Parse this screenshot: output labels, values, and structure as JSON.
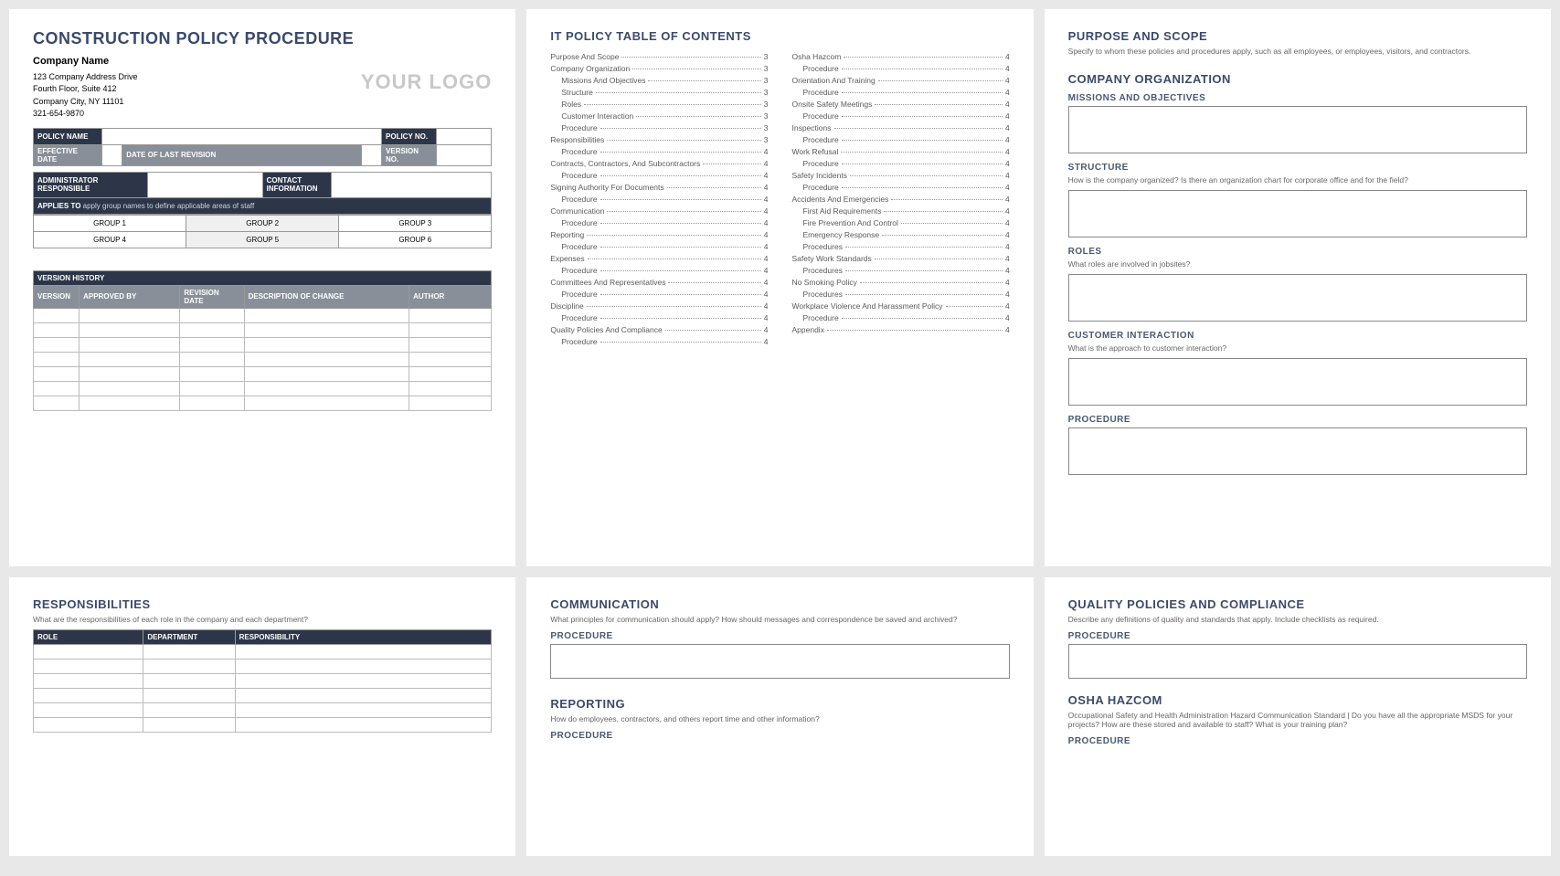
{
  "p1": {
    "title": "CONSTRUCTION POLICY PROCEDURE",
    "company_name": "Company Name",
    "addr1": "123 Company Address Drive",
    "addr2": "Fourth Floor, Suite 412",
    "addr3": "Company City, NY  11101",
    "phone": "321-654-9870",
    "logo": "YOUR LOGO",
    "policy_name": "POLICY NAME",
    "policy_no": "POLICY NO.",
    "effective_date": "EFFECTIVE DATE",
    "last_rev": "DATE OF LAST REVISION",
    "version_no": "VERSION NO.",
    "admin": "ADMINISTRATOR RESPONSIBLE",
    "contact": "CONTACT INFORMATION",
    "applies_lbl": "APPLIES TO",
    "applies_txt": "apply group names to define applicable areas of staff",
    "g1": "GROUP 1",
    "g2": "GROUP 2",
    "g3": "GROUP 3",
    "g4": "GROUP 4",
    "g5": "GROUP 5",
    "g6": "GROUP 6",
    "ver_hist": "VERSION HISTORY",
    "vh_version": "VERSION",
    "vh_approved": "APPROVED BY",
    "vh_revdate": "REVISION DATE",
    "vh_desc": "DESCRIPTION OF CHANGE",
    "vh_author": "AUTHOR"
  },
  "p2": {
    "title": "IT POLICY TABLE OF CONTENTS",
    "col1": [
      {
        "t": "Purpose And Scope",
        "p": "3",
        "i": 0
      },
      {
        "t": "Company Organization",
        "p": "3",
        "i": 0
      },
      {
        "t": "Missions And Objectives",
        "p": "3",
        "i": 1
      },
      {
        "t": "Structure",
        "p": "3",
        "i": 1
      },
      {
        "t": "Roles",
        "p": "3",
        "i": 1
      },
      {
        "t": "Customer Interaction",
        "p": "3",
        "i": 1
      },
      {
        "t": "Procedure",
        "p": "3",
        "i": 1
      },
      {
        "t": "Responsibilities",
        "p": "3",
        "i": 0
      },
      {
        "t": "Procedure",
        "p": "4",
        "i": 1
      },
      {
        "t": "Contracts, Contractors, And Subcontractors",
        "p": "4",
        "i": 0
      },
      {
        "t": "Procedure",
        "p": "4",
        "i": 1
      },
      {
        "t": "Signing Authority For Documents",
        "p": "4",
        "i": 0
      },
      {
        "t": "Procedure",
        "p": "4",
        "i": 1
      },
      {
        "t": "Communication",
        "p": "4",
        "i": 0
      },
      {
        "t": "Procedure",
        "p": "4",
        "i": 1
      },
      {
        "t": "Reporting",
        "p": "4",
        "i": 0
      },
      {
        "t": "Procedure",
        "p": "4",
        "i": 1
      },
      {
        "t": "Expenses",
        "p": "4",
        "i": 0
      },
      {
        "t": "Procedure",
        "p": "4",
        "i": 1
      },
      {
        "t": "Committees And Representatives",
        "p": "4",
        "i": 0
      },
      {
        "t": "Procedure",
        "p": "4",
        "i": 1
      },
      {
        "t": "Discipline",
        "p": "4",
        "i": 0
      },
      {
        "t": "Procedure",
        "p": "4",
        "i": 1
      },
      {
        "t": "Quality Policies And Compliance",
        "p": "4",
        "i": 0
      },
      {
        "t": "Procedure",
        "p": "4",
        "i": 1
      }
    ],
    "col2": [
      {
        "t": "Osha Hazcom",
        "p": "4",
        "i": 0
      },
      {
        "t": "Procedure",
        "p": "4",
        "i": 1
      },
      {
        "t": "Orientation And Training",
        "p": "4",
        "i": 0
      },
      {
        "t": "Procedure",
        "p": "4",
        "i": 1
      },
      {
        "t": "Onsite Safety Meetings",
        "p": "4",
        "i": 0
      },
      {
        "t": "Procedure",
        "p": "4",
        "i": 1
      },
      {
        "t": "Inspections",
        "p": "4",
        "i": 0
      },
      {
        "t": "Procedure",
        "p": "4",
        "i": 1
      },
      {
        "t": "Work Refusal",
        "p": "4",
        "i": 0
      },
      {
        "t": "Procedure",
        "p": "4",
        "i": 1
      },
      {
        "t": "Safety Incidents",
        "p": "4",
        "i": 0
      },
      {
        "t": "Procedure",
        "p": "4",
        "i": 1
      },
      {
        "t": "Accidents And Emergencies",
        "p": "4",
        "i": 0
      },
      {
        "t": "First Aid Requirements",
        "p": "4",
        "i": 1
      },
      {
        "t": "Fire Prevention And Control",
        "p": "4",
        "i": 1
      },
      {
        "t": "Emergency Response",
        "p": "4",
        "i": 1
      },
      {
        "t": "Procedures",
        "p": "4",
        "i": 1
      },
      {
        "t": "Safety Work Standards",
        "p": "4",
        "i": 0
      },
      {
        "t": "Procedures",
        "p": "4",
        "i": 1
      },
      {
        "t": "No Smoking Policy",
        "p": "4",
        "i": 0
      },
      {
        "t": "Procedures",
        "p": "4",
        "i": 1
      },
      {
        "t": "Workplace Violence And Harassment Policy",
        "p": "4",
        "i": 0
      },
      {
        "t": "Procedure",
        "p": "4",
        "i": 1
      },
      {
        "t": "Appendix",
        "p": "4",
        "i": 0
      }
    ]
  },
  "p3": {
    "t1": "PURPOSE AND SCOPE",
    "t1_txt": "Specify to whom these policies and procedures apply, such as all employees, or employees, visitors, and contractors.",
    "t2": "COMPANY ORGANIZATION",
    "s1": "MISSIONS AND OBJECTIVES",
    "s2": "STRUCTURE",
    "s2_txt": "How is the company organized? Is there an organization chart for corporate office and for the field?",
    "s3": "ROLES",
    "s3_txt": "What roles are involved in jobsites?",
    "s4": "CUSTOMER INTERACTION",
    "s4_txt": "What is the approach to customer interaction?",
    "s5": "PROCEDURE"
  },
  "p4": {
    "title": "RESPONSIBILITIES",
    "txt": "What are the responsibilities of each role in the company and each department?",
    "h1": "ROLE",
    "h2": "DEPARTMENT",
    "h3": "RESPONSIBILITY"
  },
  "p5": {
    "t1": "COMMUNICATION",
    "t1_txt": "What principles for communication should apply?  How should messages and correspondence be saved and archived?",
    "proc": "PROCEDURE",
    "t2": "REPORTING",
    "t2_txt": "How do employees, contractors, and others report time and other information?"
  },
  "p6": {
    "t1": "QUALITY POLICIES AND COMPLIANCE",
    "t1_txt": "Describe any definitions of quality and standards that apply.  Include checklists as required.",
    "proc": "PROCEDURE",
    "t2": "OSHA HAZCOM",
    "t2_txt": "Occupational Safety and Health Administration Hazard Communication Standard |  Do you have all the appropriate MSDS for your projects?  How are these stored and available to staff?  What is your training plan?"
  }
}
